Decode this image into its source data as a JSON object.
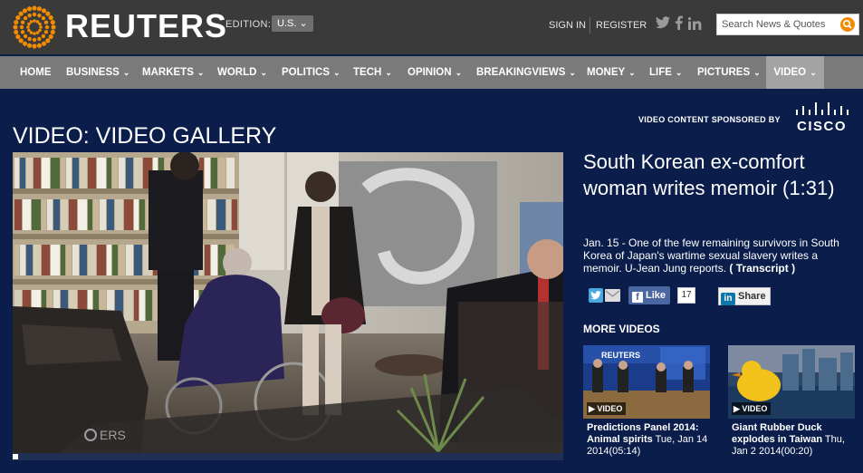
{
  "brand": {
    "name": "REUTERS"
  },
  "edition": {
    "label": "EDITION:",
    "value": "U.S."
  },
  "account": {
    "signin": "SIGN IN",
    "register": "REGISTER"
  },
  "social": [
    "twitter-icon",
    "facebook-icon",
    "linkedin-icon"
  ],
  "search": {
    "placeholder": "Search News & Quotes"
  },
  "nav": {
    "items": [
      "HOME",
      "BUSINESS",
      "MARKETS",
      "WORLD",
      "POLITICS",
      "TECH",
      "OPINION",
      "BREAKINGVIEWS",
      "MONEY",
      "LIFE",
      "PICTURES",
      "VIDEO"
    ],
    "active": "VIDEO"
  },
  "sponsor": {
    "label": "VIDEO CONTENT SPONSORED BY",
    "brand": "CISCO"
  },
  "page": {
    "title": "VIDEO: VIDEO GALLERY"
  },
  "video": {
    "watermark": "ERS",
    "progress": 0.01
  },
  "story": {
    "title": "South Korean ex-comfort woman writes memoir (1:31)",
    "description": "Jan. 15 - One of the few remaining survivors in South Korea of Japan's wartime sexual slavery writes a memoir. U-Jean Jung reports.",
    "transcript": "( Transcript )"
  },
  "share": {
    "like_label": "Like",
    "like_count": "17",
    "linkedin_label": "Share"
  },
  "more_videos": {
    "heading": "MORE VIDEOS",
    "items": [
      {
        "badge": "VIDEO",
        "title": "Predictions Panel 2014: Animal spirits",
        "date": "Tue, Jan 14 2014(05:14)",
        "thumb_brand": "REUTERS"
      },
      {
        "badge": "VIDEO",
        "title": "Giant Rubber Duck explodes in Taiwan",
        "date": "Thu, Jan 2 2014(00:20)"
      }
    ]
  },
  "colors": {
    "background": "#0b1d4a",
    "topbar": "#3a3a3a",
    "navbar": "#7a7a7a",
    "active_nav": "#a3a3a3",
    "logo_accent": "#f28b00"
  }
}
